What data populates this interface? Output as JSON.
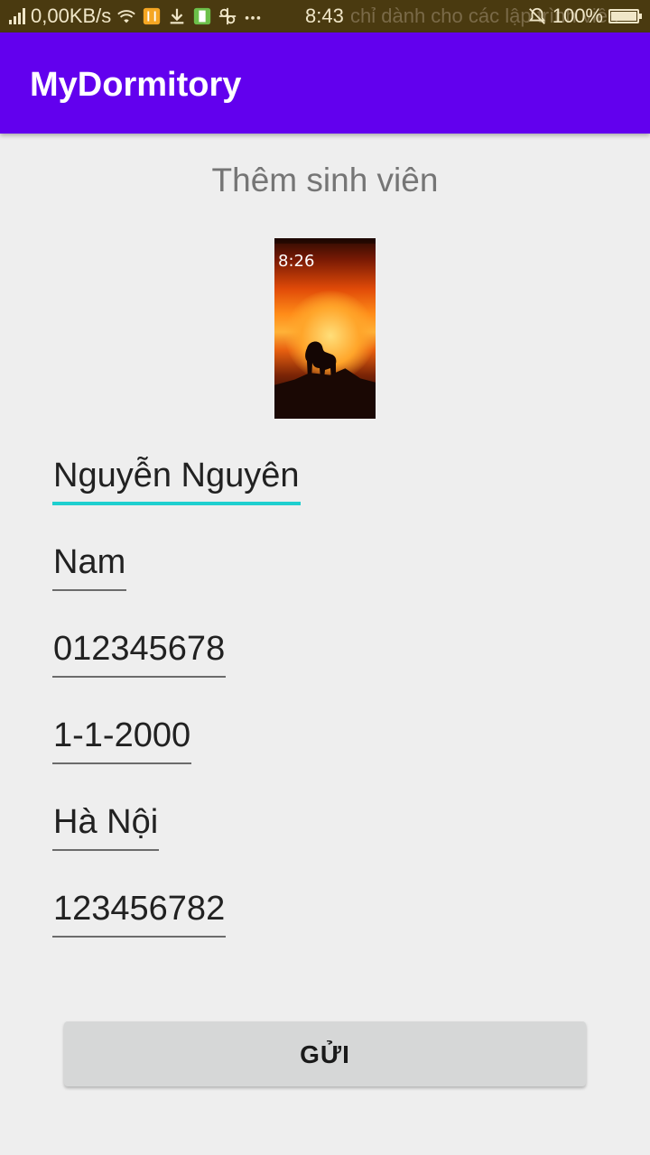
{
  "status_bar": {
    "network_speed": "0,00KB/s",
    "time": "8:43",
    "notification_ghost": "chỉ dành cho các lập trình viên",
    "battery": "100%",
    "battery_level": 1.0,
    "icons": [
      "signal-icon",
      "wifi-icon",
      "app-icon",
      "download-icon",
      "battery-saver-icon",
      "usb-icon",
      "more-icon",
      "mute-icon"
    ]
  },
  "app_bar": {
    "title": "MyDormitory",
    "color": "#6200ee"
  },
  "screen": {
    "title": "Thêm sinh viên",
    "photo_time": "8:26"
  },
  "form": {
    "name": "Nguyễn Nguyên",
    "gender": "Nam",
    "phone": "012345678",
    "birthday": "1-1-2000",
    "address": "Hà Nội",
    "id_number": "123456782",
    "accent_color": "#1ecfcf"
  },
  "actions": {
    "submit_label": "GỬI"
  }
}
